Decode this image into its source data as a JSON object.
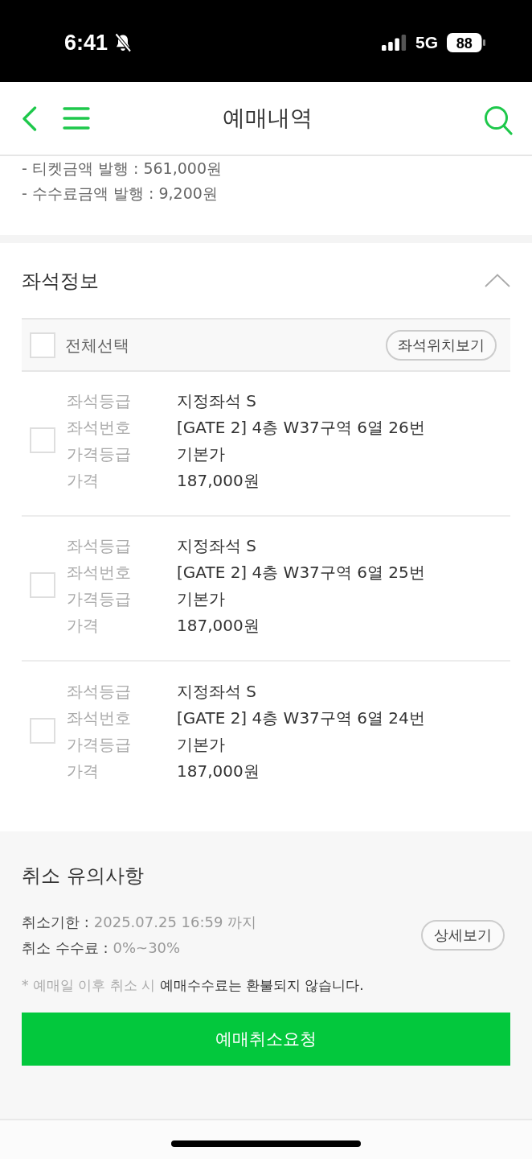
{
  "status_bar": {
    "time": "6:41",
    "network": "5G",
    "battery": "88"
  },
  "header": {
    "title": "예매내역"
  },
  "issue_lines": [
    "- 티켓금액 발행 : 561,000원",
    "- 수수료금액 발행 : 9,200원"
  ],
  "seat_section": {
    "title": "좌석정보",
    "expanded": true,
    "select_all": {
      "label": "전체선택",
      "checked": false
    },
    "map_button": "좌석위치보기",
    "seats": [
      {
        "checked": false,
        "fields": [
          {
            "label": "좌석등급",
            "value": "지정좌석 S"
          },
          {
            "label": "좌석번호",
            "value": "[GATE 2] 4층 W37구역 6열 26번"
          },
          {
            "label": "가격등급",
            "value": "기본가"
          },
          {
            "label": "가격",
            "value": "187,000원"
          }
        ]
      },
      {
        "checked": false,
        "fields": [
          {
            "label": "좌석등급",
            "value": "지정좌석 S"
          },
          {
            "label": "좌석번호",
            "value": "[GATE 2] 4층 W37구역 6열 25번"
          },
          {
            "label": "가격등급",
            "value": "기본가"
          },
          {
            "label": "가격",
            "value": "187,000원"
          }
        ]
      },
      {
        "checked": false,
        "fields": [
          {
            "label": "좌석등급",
            "value": "지정좌석 S"
          },
          {
            "label": "좌석번호",
            "value": "[GATE 2] 4층 W37구역 6열 24번"
          },
          {
            "label": "가격등급",
            "value": "기본가"
          },
          {
            "label": "가격",
            "value": "187,000원"
          }
        ]
      }
    ]
  },
  "cancel_section": {
    "title": "취소 유의사항",
    "terms": [
      {
        "label": "취소기한 :",
        "value": "2025.07.25 16:59 까지"
      },
      {
        "label": "취소 수수료 :",
        "value": "0%~30%"
      }
    ],
    "detail_button": "상세보기",
    "note": "* 예매일 이후 취소 시 **예매수수료는 환불되지 않습니다.**",
    "cancel_button": "예매취소요청"
  }
}
